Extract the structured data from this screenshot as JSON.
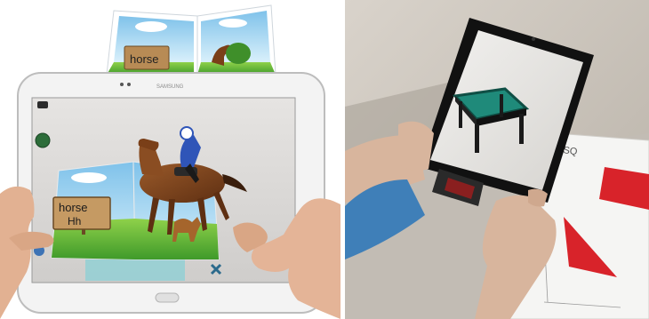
{
  "left_photo": {
    "book_top_sign": "horse",
    "screen_sign_word": "horse",
    "screen_sign_letters": "Hh",
    "tablet_brand_mark": "SAMSUNG"
  },
  "right_photo": {
    "paper_heading": "ARSQ",
    "colors": {
      "table_felt": "#1f8a7a",
      "red_shape": "#d8232a"
    }
  }
}
